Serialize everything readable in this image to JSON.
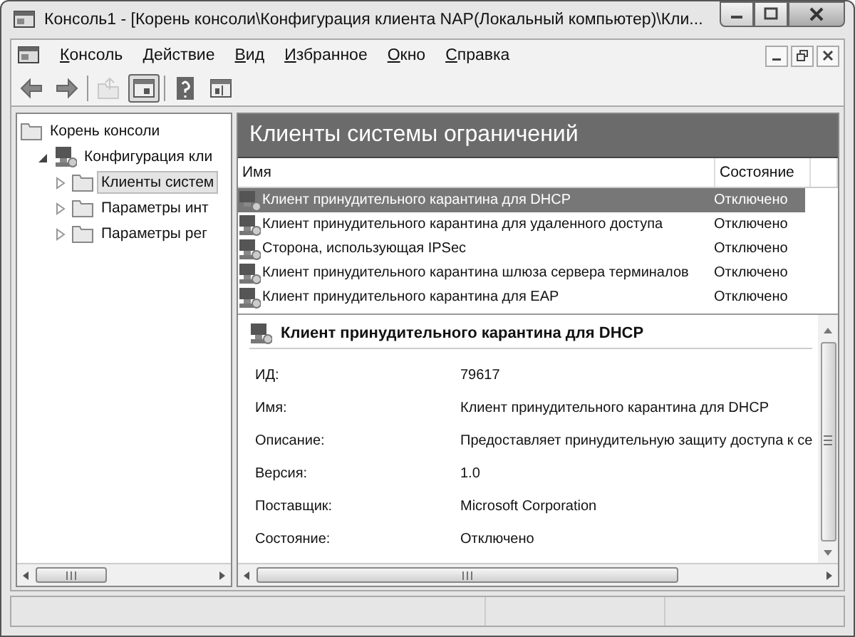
{
  "window": {
    "title": "Консоль1 - [Корень консоли\\Конфигурация клиента NAP(Локальный компьютер)\\Кли..."
  },
  "menu": [
    {
      "label": "Консоль"
    },
    {
      "label": "Действие"
    },
    {
      "label": "Вид"
    },
    {
      "label": "Избранное"
    },
    {
      "label": "Окно"
    },
    {
      "label": "Справка"
    }
  ],
  "toolbar": [
    {
      "kind": "back",
      "disabled": false,
      "on": false
    },
    {
      "kind": "forward",
      "disabled": false,
      "on": false
    },
    {
      "kind": "up",
      "disabled": true,
      "on": false
    },
    {
      "kind": "tree",
      "disabled": false,
      "on": true
    },
    {
      "kind": "help",
      "disabled": false,
      "on": false
    },
    {
      "kind": "pane",
      "disabled": false,
      "on": false
    }
  ],
  "tree": [
    {
      "label": "Корень консоли",
      "selected": false,
      "kind": "folder",
      "children": [
        {
          "label": "Конфигурация кли",
          "expanded": true,
          "selected": false,
          "kind": "config",
          "children": [
            {
              "label": "Клиенты систем",
              "expanded": false,
              "selected": true,
              "kind": "folder"
            },
            {
              "label": "Параметры инт",
              "expanded": false,
              "selected": false,
              "kind": "folder"
            },
            {
              "label": "Параметры рег",
              "expanded": false,
              "selected": false,
              "kind": "folder"
            }
          ]
        }
      ]
    }
  ],
  "panel": {
    "title": "Клиенты системы ограничений"
  },
  "table": {
    "columns": [
      "Имя",
      "Состояние"
    ],
    "rows": [
      {
        "name": "Клиент принудительного карантина для DHCP",
        "state": "Отключено",
        "selected": true
      },
      {
        "name": "Клиент принудительного карантина для удаленного доступа",
        "state": "Отключено",
        "selected": false
      },
      {
        "name": "Сторона, использующая IPSec",
        "state": "Отключено",
        "selected": false
      },
      {
        "name": "Клиент принудительного карантина шлюза сервера терминалов",
        "state": "Отключено",
        "selected": false
      },
      {
        "name": "Клиент принудительного карантина для EAP",
        "state": "Отключено",
        "selected": false
      }
    ]
  },
  "details": {
    "title": "Клиент принудительного карантина для DHCP",
    "fields": [
      {
        "label": "ИД:",
        "value": "79617"
      },
      {
        "label": "Имя:",
        "value": "Клиент принудительного карантина для DHCP"
      },
      {
        "label": "Описание:",
        "value": "Предоставляет принудительную защиту доступа к се"
      },
      {
        "label": "Версия:",
        "value": "1.0"
      },
      {
        "label": "Поставщик:",
        "value": "Microsoft Corporation"
      },
      {
        "label": "Состояние:",
        "value": "Отключено"
      }
    ]
  }
}
